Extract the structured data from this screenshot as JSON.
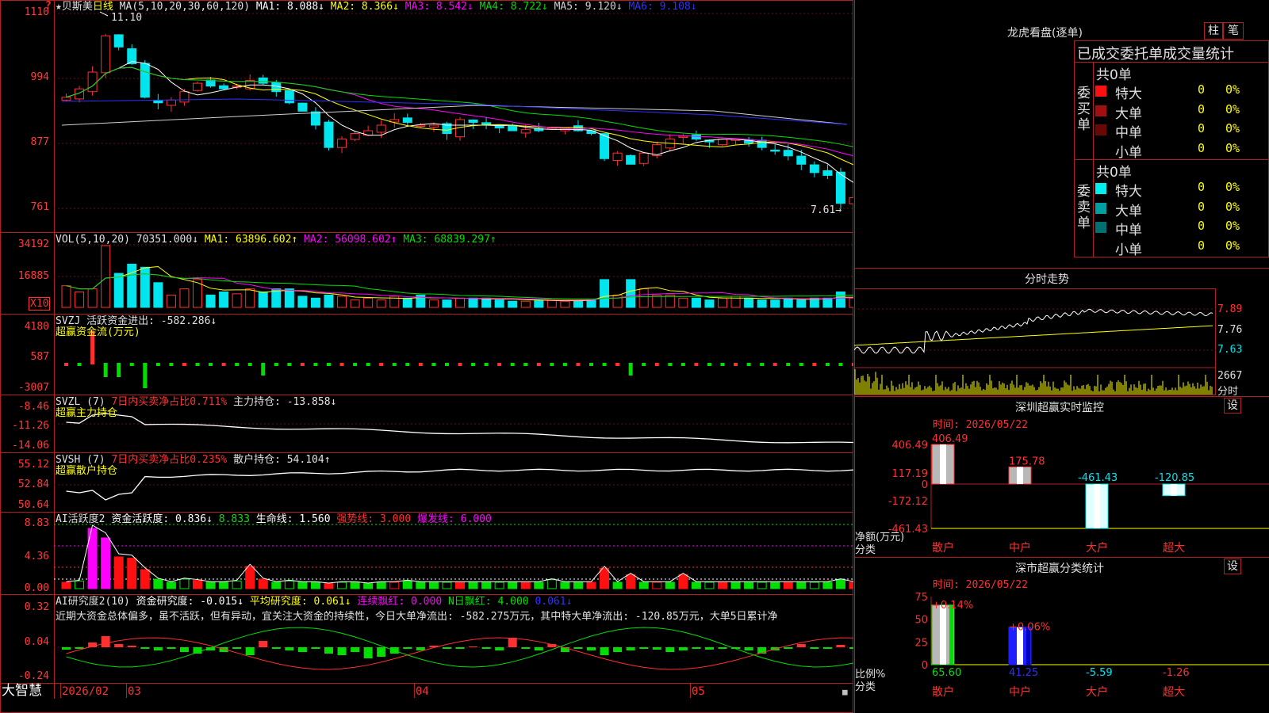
{
  "colors": {
    "up": "#ff3030",
    "down": "#00e5ee",
    "frame": "#b02020",
    "grid": "#661010"
  },
  "stock": {
    "name": "★贝斯美",
    "period": "日线"
  },
  "main_axis": [
    "1110",
    "994",
    "877",
    "761"
  ],
  "price_ma": {
    "title": "MA(5,10,20,30,60,120)",
    "items": [
      {
        "label": "MA1: 8.088↓",
        "color": "#ffffff"
      },
      {
        "label": "MA2: 8.366↓",
        "color": "#ffff00"
      },
      {
        "label": "MA3: 8.542↓",
        "color": "#ff00ff"
      },
      {
        "label": "MA4: 8.722↓",
        "color": "#00e000"
      },
      {
        "label": "MA5: 9.120↓",
        "color": "#d0d0d0"
      },
      {
        "label": "MA6: 9.108↓",
        "color": "#3030ff"
      }
    ],
    "high_label": "11.10",
    "low_label": "7.61→"
  },
  "vol": {
    "title": "VOL(5,10,20)",
    "value": "70351.000↓",
    "items": [
      {
        "label": "MA1: 63896.602↑",
        "color": "#ffff00"
      },
      {
        "label": "MA2: 56098.602↑",
        "color": "#ff00ff"
      },
      {
        "label": "MA3: 68839.297↑",
        "color": "#00e000"
      }
    ],
    "axis": [
      "34192",
      "16885"
    ],
    "unit": "X10"
  },
  "svzj": {
    "title": "SVZJ  活跃资金进出: -582.286↓",
    "subtitle": "超赢资金流(万元)",
    "axis": [
      "4180",
      "587",
      "-3007"
    ]
  },
  "svzl": {
    "title": "SVZL (7)",
    "ratio": "7日内买卖净占比0.711%",
    "hold": "主力持仓: -13.858↓",
    "subtitle": "超赢主力持仓",
    "axis": [
      "-8.46",
      "-11.26",
      "-14.06"
    ]
  },
  "svsh": {
    "title": "SVSH (7)",
    "ratio": "7日内买卖净占比0.235%",
    "hold": "散户持仓: 54.104↑",
    "subtitle": "超赢散户持仓",
    "axis": [
      "55.12",
      "52.84",
      "50.64"
    ]
  },
  "ai1": {
    "title": "AI活跃度2",
    "items": [
      {
        "label": "资金活跃度: 0.836↓",
        "color": "#ffffff"
      },
      {
        "label": "8.833",
        "color": "#00e000"
      },
      {
        "label": "生命线: 1.560",
        "color": "#ffffff"
      },
      {
        "label": "强势线: 3.000",
        "color": "#ff3030"
      },
      {
        "label": "爆发线: 6.000",
        "color": "#ff00ff"
      }
    ],
    "axis": [
      "8.83",
      "4.36",
      "0.00"
    ]
  },
  "ai2": {
    "title": "AI研究度2(10)",
    "items": [
      {
        "label": "资金研究度: -0.015↓",
        "color": "#ffffff"
      },
      {
        "label": "平均研究度: 0.061↓",
        "color": "#ffff00"
      },
      {
        "label": "连续飘红: 0.000",
        "color": "#ff00ff"
      },
      {
        "label": "N日飘红: 4.000",
        "color": "#00e000"
      },
      {
        "label": "0.061↓",
        "color": "#3030ff"
      }
    ],
    "note": "近期大资金总体偏多，虽不活跃，但有异动，宜关注大资金的持续性，今日大单净流出: -582.275万元，其中特大单净流出: -120.85万元，大单5日累计净",
    "axis": [
      "0.32",
      "0.04",
      "-0.24"
    ]
  },
  "footer": {
    "brand": "大智慧",
    "dates": [
      "2026/02",
      "03",
      "04",
      "05"
    ]
  },
  "right_panel": {
    "title": "龙虎看盘(逐单)",
    "tab_buttons": [
      "柱",
      "笔"
    ],
    "table_header": "已成交委托单成交量统计",
    "buy": {
      "side_label": "委买单",
      "total": "共0单",
      "rows": [
        {
          "label": "特大",
          "value": "0",
          "pct": "0%",
          "color": "#ff1010"
        },
        {
          "label": "大单",
          "value": "0",
          "pct": "0%",
          "color": "#a01010"
        },
        {
          "label": "中单",
          "value": "0",
          "pct": "0%",
          "color": "#6a0808"
        },
        {
          "label": "小单",
          "value": "0",
          "pct": "0%",
          "color": ""
        }
      ]
    },
    "sell": {
      "side_label": "委卖单",
      "total": "共0单",
      "rows": [
        {
          "label": "特大",
          "value": "0",
          "pct": "0%",
          "color": "#00f0f0"
        },
        {
          "label": "大单",
          "value": "0",
          "pct": "0%",
          "color": "#00a0a0"
        },
        {
          "label": "中单",
          "value": "0",
          "pct": "0%",
          "color": "#007070"
        },
        {
          "label": "小单",
          "value": "0",
          "pct": "0%",
          "color": ""
        }
      ]
    },
    "intraday": {
      "title": "分时走势",
      "axis": [
        "7.89",
        "7.76",
        "7.63"
      ],
      "vol_top": "2667",
      "vol_unit": "分时"
    },
    "sz_monitor": {
      "title": "深圳超赢实时监控",
      "settings": "设",
      "time": "时间: 2026/05/22",
      "axis": [
        "406.49",
        "117.19",
        "0",
        "-172.12",
        "-461.43"
      ],
      "ylabel": "净额(万元)",
      "xlabel": "分类",
      "categories": [
        "散户",
        "中户",
        "大户",
        "超大"
      ],
      "values": [
        406.49,
        175.78,
        -461.43,
        -120.85
      ],
      "value_labels": [
        "406.49",
        "175.78",
        "-461.43",
        "-120.85"
      ]
    },
    "sz_class": {
      "title": "深市超赢分类统计",
      "settings": "设",
      "time": "时间: 2026/05/22",
      "axis": [
        "75",
        "50",
        "25",
        "0"
      ],
      "ylabel": "比例%",
      "xlabel": "分类",
      "categories": [
        "散户",
        "中户",
        "大户",
        "超大"
      ],
      "top_labels": [
        "+0.14%",
        "+0.06%"
      ],
      "bottom_labels": [
        "65.60",
        "41.25",
        "-5.59",
        "-1.26"
      ],
      "bar_values": [
        65.6,
        41.25
      ]
    }
  },
  "chart_data": [
    {
      "type": "bar",
      "title": "深圳超赢实时监控",
      "categories": [
        "散户",
        "中户",
        "大户",
        "超大"
      ],
      "values": [
        406.49,
        175.78,
        -461.43,
        -120.85
      ],
      "ylabel": "净额(万元)",
      "xlabel": "分类",
      "ylim": [
        -461.43,
        406.49
      ]
    },
    {
      "type": "bar",
      "title": "深市超赢分类统计",
      "categories": [
        "散户",
        "中户",
        "大户",
        "超大"
      ],
      "values": [
        65.6,
        41.25,
        -5.59,
        -1.26
      ],
      "ylabel": "比例%",
      "xlabel": "分类",
      "ylim": [
        0,
        75
      ]
    }
  ]
}
